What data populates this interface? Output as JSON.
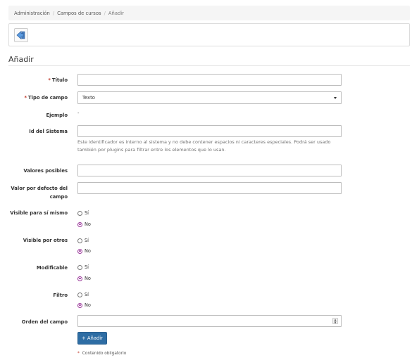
{
  "breadcrumb": {
    "items": [
      "Administración",
      "Campos de cursos",
      "Añadir"
    ],
    "separator": "/"
  },
  "toolbar": {
    "back_icon": "back-arrow-icon"
  },
  "page_title": "Añadir",
  "form": {
    "required_mark": "*",
    "titulo_label": "Título",
    "tipo_label": "Tipo de campo",
    "tipo_value": "Texto",
    "ejemplo_label": "Ejemplo",
    "ejemplo_value": "-",
    "id_label": "Id del Sistema",
    "id_help": "Este identificador es interno al sistema y no debe contener espacios ni caracteres especiales. Podrá ser usado también por plugins para filtrar entre los elementos que lo usan.",
    "valores_label": "Valores posibles",
    "valor_defecto_label_line1": "Valor por defecto del",
    "valor_defecto_label_line2": "campo",
    "visible_mismo_label": "Visible para sí mismo",
    "visible_otros_label": "Visible por otros",
    "modificable_label": "Modificable",
    "filtro_label": "Filtro",
    "orden_label": "Orden del campo",
    "option_si": "Sí",
    "option_no": "No",
    "submit_label": "+ Añadir",
    "required_note": "Contenido obligatorio"
  },
  "colors": {
    "primary_button": "#2e6da4",
    "required_asterisk": "#c0392b",
    "radio_checked": "#9b3a9b"
  }
}
